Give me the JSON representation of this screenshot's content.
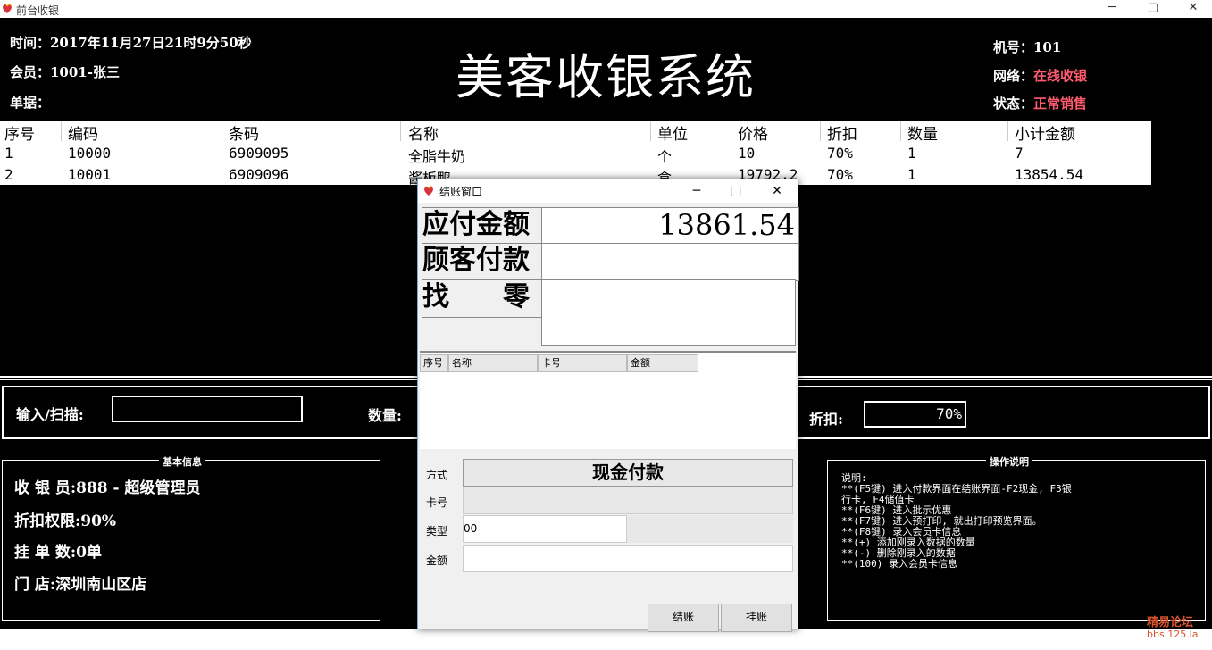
{
  "window": {
    "title": "前台收银",
    "min": "─",
    "max": "▢",
    "close": "✕"
  },
  "header": {
    "time": "时间：2017年11月27日21时9分50秒",
    "member": "会员：1001-张三",
    "doc": "单据：",
    "app_title": "美客收银系统",
    "machine": "机号：101",
    "network_label": "网络：",
    "network_value": "在线收银",
    "status_label": "状态：",
    "status_value": "正常销售"
  },
  "grid": {
    "columns": [
      "序号",
      "编码",
      "条码",
      "名称",
      "单位",
      "价格",
      "折扣",
      "数量",
      "小计金额"
    ],
    "rows": [
      [
        "1",
        "10000",
        "6909095",
        "全脂牛奶",
        "个",
        "10",
        "70%",
        "1",
        "7"
      ],
      [
        "2",
        "10001",
        "6909096",
        "酱板鸭",
        "盒",
        "19792.2",
        "70%",
        "1",
        "13854.54"
      ]
    ]
  },
  "input_bar": {
    "scan_label": "输入/扫描:",
    "scan_value": "",
    "qty_label": "数量:",
    "discount_label": "折扣:",
    "discount_value": "70%"
  },
  "basic_info": {
    "title": "基本信息",
    "cashier": "收 银 员:888 - 超级管理员",
    "discount_limit": "折扣权限:90%",
    "pending": "挂 单 数:0单",
    "store": "门      店:深圳南山区店"
  },
  "ops": {
    "title": "操作说明",
    "text": "说明:\n**(F5键) 进入付款界面在结账界面-F2现金, F3银\n行卡, F4储值卡\n**(F6键) 进入批示优惠\n**(F7键) 进入预打印, 就出打印预览界面。\n**(F8键) 录入会员卡信息\n**(+) 添加刚录入数据的数量\n**(-) 删除刚录入的数据\n**(100) 录入会员卡信息"
  },
  "dialog": {
    "title": "结账窗口",
    "due_label": "应付金额",
    "due_value": "13861.54",
    "paid_label": "顾客付款",
    "paid_value": "",
    "change_label": "找　　零",
    "change_value": "",
    "table_headers": [
      "序号",
      "名称",
      "卡号",
      "金额"
    ],
    "method_label": "方式",
    "method_value": "现金付款",
    "card_label": "卡号",
    "card_value": "",
    "type_label": "类型",
    "type_value": "00",
    "amount_label": "金额",
    "amount_value": "",
    "checkout_button": "结账",
    "hold_button": "挂账"
  },
  "watermark": {
    "line1": "精易论坛",
    "line2": "bbs.125.la"
  },
  "colors": {
    "background": "#000000",
    "accent_red": "#ff5a6e"
  }
}
